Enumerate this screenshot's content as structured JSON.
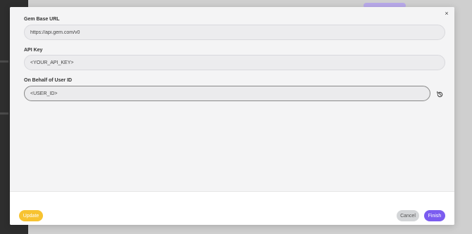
{
  "dialog": {
    "close_glyph": "×",
    "fields": [
      {
        "label": "Gem Base URL",
        "value": "https://api.gem.com/v0"
      },
      {
        "label": "API Key",
        "value": "<YOUR_API_KEY>"
      },
      {
        "label": "On Behalf of User ID",
        "value": "<USER_ID>"
      }
    ],
    "reset_icon": "reset-icon"
  },
  "footer": {
    "update_label": "Update",
    "cancel_label": "Cancel",
    "finish_label": "Finish"
  },
  "colors": {
    "update_button": "#f7c331",
    "finish_button": "#7b5cf0",
    "cancel_button": "#d4d6d8"
  }
}
